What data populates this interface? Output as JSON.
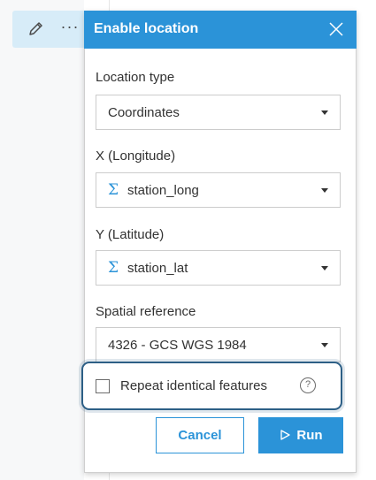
{
  "toolbar": {
    "pencil_icon": "pencil-icon",
    "more_label": "···"
  },
  "panel": {
    "title": "Enable location",
    "close_icon": "close-icon",
    "header_color": "#2b93d8"
  },
  "location_type": {
    "label": "Location type",
    "value": "Coordinates"
  },
  "x_field": {
    "label": "X (Longitude)",
    "icon": "sigma-icon",
    "icon_glyph": "Σ",
    "value": "station_long"
  },
  "y_field": {
    "label": "Y (Latitude)",
    "icon": "sigma-icon",
    "icon_glyph": "Σ",
    "value": "station_lat"
  },
  "spatial_reference": {
    "label": "Spatial reference",
    "value": "4326 - GCS WGS 1984"
  },
  "repeat": {
    "label": "Repeat identical features",
    "checked": false,
    "help_glyph": "?"
  },
  "buttons": {
    "cancel_label": "Cancel",
    "run_label": "Run"
  }
}
